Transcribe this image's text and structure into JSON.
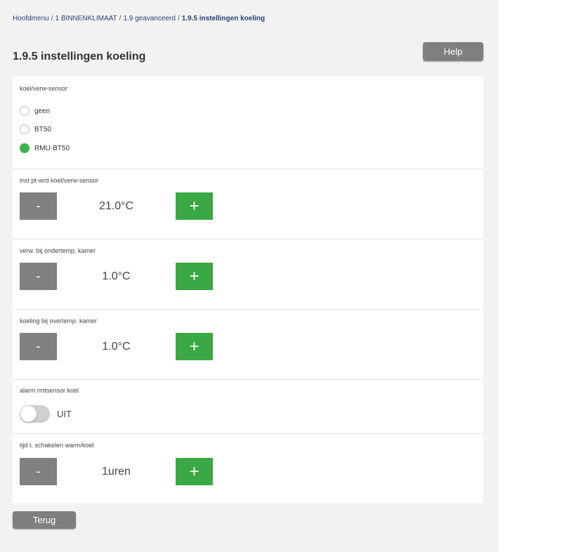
{
  "breadcrumb": [
    "Hoofdmenu",
    "1 BINNENKLIMAAT",
    "1.9 geavanceerd",
    "1.9.5 instellingen koeling"
  ],
  "page_title": "1.9.5 instellingen koeling",
  "help_label": "Help",
  "back_label": "Terug",
  "sensor": {
    "label": "koel/verw-sensor",
    "options": [
      {
        "label": "geen",
        "selected": false
      },
      {
        "label": "BT50",
        "selected": false
      },
      {
        "label": "RMU-BT50",
        "selected": true
      }
    ]
  },
  "steppers": [
    {
      "label": "inst pt-wrd koel/verw-sensor",
      "value": "21.0°C",
      "minus": "-",
      "plus": "+"
    },
    {
      "label": "verw. bij ondertemp. kamer",
      "value": "1.0°C",
      "minus": "-",
      "plus": "+"
    },
    {
      "label": "koeling bij overtemp. kamer",
      "value": "1.0°C",
      "minus": "-",
      "plus": "+"
    },
    {
      "label": "tijd t. schakelen warm/koel",
      "value": "1uren",
      "minus": "-",
      "plus": "+"
    }
  ],
  "alarm": {
    "label": "alarm rmtsensor koel",
    "state": "UIT",
    "on": false
  },
  "colors": {
    "accent_green": "#3aa844",
    "button_grey": "#808080"
  }
}
